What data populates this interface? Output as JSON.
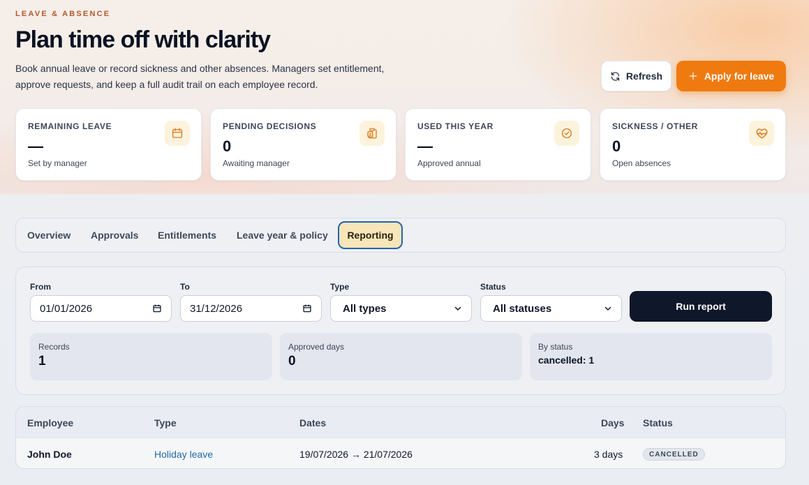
{
  "header": {
    "eyebrow": "LEAVE & ABSENCE",
    "title": "Plan time off with clarity",
    "subtitle": "Book annual leave or record sickness and other absences. Managers set entitlement, approve requests, and keep a full audit trail on each employee record.",
    "refresh_label": "Refresh",
    "apply_label": "Apply for leave"
  },
  "stats": [
    {
      "label": "REMAINING LEAVE",
      "value": "—",
      "sub": "Set by manager",
      "icon": "calendar-icon"
    },
    {
      "label": "PENDING DECISIONS",
      "value": "0",
      "sub": "Awaiting manager",
      "icon": "clipboard-icon"
    },
    {
      "label": "USED THIS YEAR",
      "value": "—",
      "sub": "Approved annual",
      "icon": "check-circle-icon"
    },
    {
      "label": "SICKNESS / OTHER",
      "value": "0",
      "sub": "Open absences",
      "icon": "heart-pulse-icon"
    }
  ],
  "tabs": [
    {
      "label": "Overview",
      "active": false
    },
    {
      "label": "Approvals",
      "active": false
    },
    {
      "label": "Entitlements",
      "active": false
    },
    {
      "label": "Leave year & policy",
      "active": false
    },
    {
      "label": "Reporting",
      "active": true
    }
  ],
  "filters": {
    "from_label": "From",
    "from_value": "01/01/2026",
    "to_label": "To",
    "to_value": "31/12/2026",
    "type_label": "Type",
    "type_value": "All types",
    "status_label": "Status",
    "status_value": "All statuses",
    "run_label": "Run report"
  },
  "summary": {
    "records_label": "Records",
    "records_value": "1",
    "approved_label": "Approved days",
    "approved_value": "0",
    "by_status_label": "By status",
    "by_status_value": "cancelled: 1"
  },
  "table": {
    "columns": [
      "Employee",
      "Type",
      "Dates",
      "Days",
      "Status"
    ],
    "rows": [
      {
        "employee": "John Doe",
        "type": "Holiday leave",
        "dates": "19/07/2026 → 21/07/2026",
        "days": "3 days",
        "status": "CANCELLED"
      }
    ]
  },
  "colors": {
    "accent": "#ef7a0f",
    "eyebrow": "#b4572a",
    "dark_button": "#0f172a",
    "active_tab_bg": "#f8e6b8",
    "active_tab_border": "#2563b0",
    "link": "#1f6aa8"
  }
}
